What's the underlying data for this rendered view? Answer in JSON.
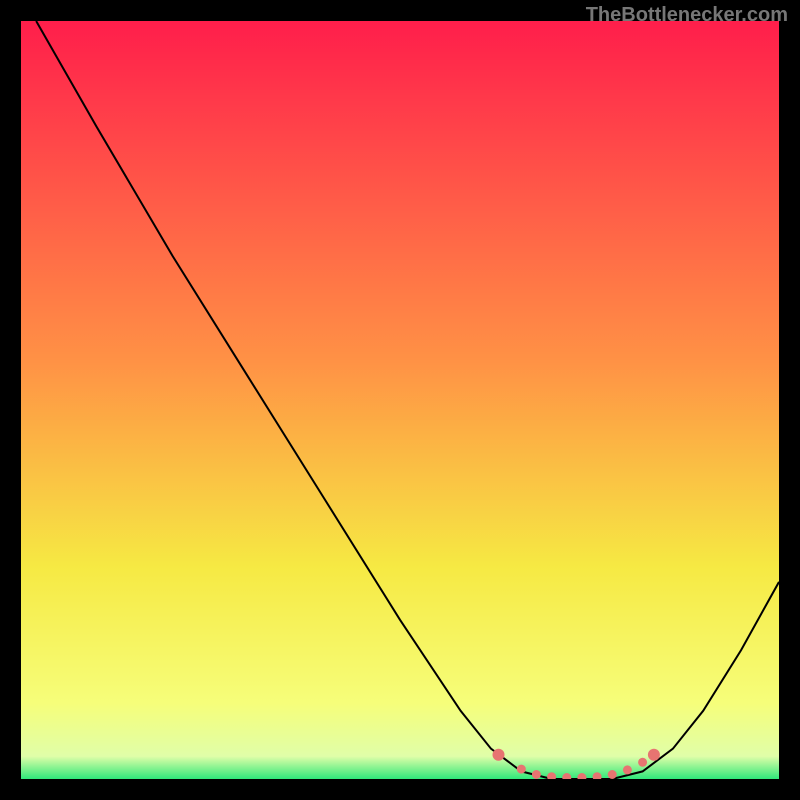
{
  "watermark": "TheBottlenecker.com",
  "chart_data": {
    "type": "line",
    "title": "",
    "xlabel": "",
    "ylabel": "",
    "xlim": [
      0,
      100
    ],
    "ylim": [
      0,
      100
    ],
    "grid": false,
    "series": [
      {
        "name": "curve",
        "color": "#000000",
        "points": [
          {
            "x": 2,
            "y": 100
          },
          {
            "x": 6,
            "y": 93
          },
          {
            "x": 10,
            "y": 86
          },
          {
            "x": 20,
            "y": 69
          },
          {
            "x": 30,
            "y": 53
          },
          {
            "x": 40,
            "y": 37
          },
          {
            "x": 50,
            "y": 21
          },
          {
            "x": 58,
            "y": 9
          },
          {
            "x": 62,
            "y": 4
          },
          {
            "x": 66,
            "y": 1
          },
          {
            "x": 70,
            "y": 0
          },
          {
            "x": 74,
            "y": 0
          },
          {
            "x": 78,
            "y": 0
          },
          {
            "x": 82,
            "y": 1
          },
          {
            "x": 86,
            "y": 4
          },
          {
            "x": 90,
            "y": 9
          },
          {
            "x": 95,
            "y": 17
          },
          {
            "x": 100,
            "y": 26
          }
        ]
      },
      {
        "name": "bottom-marker",
        "color": "#E77471",
        "points": [
          {
            "x": 63,
            "y": 3.2
          },
          {
            "x": 66,
            "y": 1.3
          },
          {
            "x": 68,
            "y": 0.6
          },
          {
            "x": 70,
            "y": 0.3
          },
          {
            "x": 72,
            "y": 0.2
          },
          {
            "x": 74,
            "y": 0.2
          },
          {
            "x": 76,
            "y": 0.3
          },
          {
            "x": 78,
            "y": 0.6
          },
          {
            "x": 80,
            "y": 1.2
          },
          {
            "x": 82,
            "y": 2.2
          },
          {
            "x": 83.5,
            "y": 3.2
          }
        ]
      }
    ],
    "background": {
      "gradient_stops": [
        {
          "pos": 0,
          "color": "#FF1E4B"
        },
        {
          "pos": 45,
          "color": "#FF9245"
        },
        {
          "pos": 72,
          "color": "#F6E943"
        },
        {
          "pos": 90,
          "color": "#F6FE7A"
        },
        {
          "pos": 97,
          "color": "#E0FEA8"
        },
        {
          "pos": 100,
          "color": "#2FE87A"
        }
      ]
    }
  }
}
